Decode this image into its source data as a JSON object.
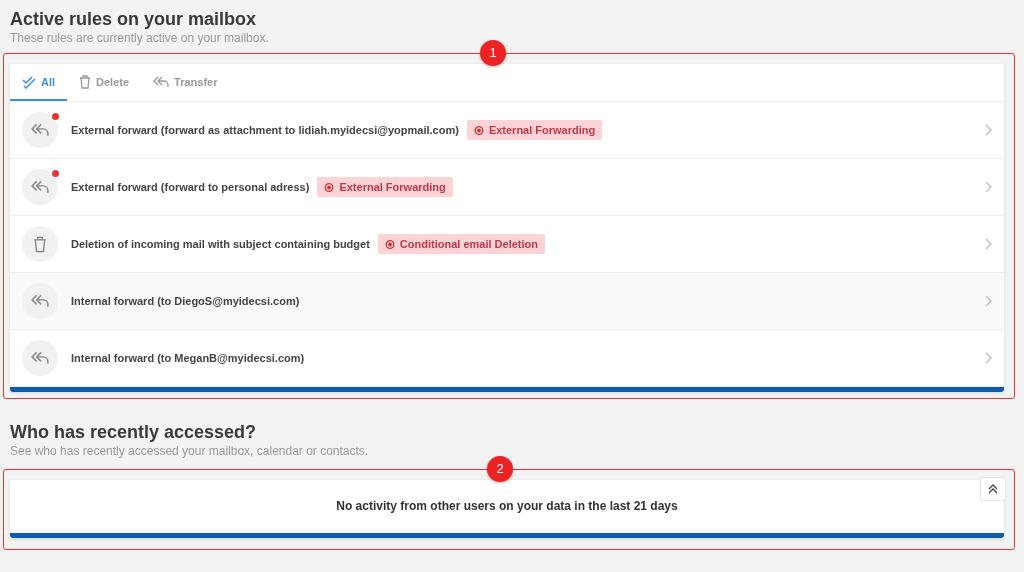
{
  "rules_section": {
    "title": "Active rules on your mailbox",
    "subtitle": "These rules are currently active on your mailbox.",
    "annotation": "1",
    "tabs": [
      {
        "label": "All",
        "selected": true
      },
      {
        "label": "Delete",
        "selected": false
      },
      {
        "label": "Transfer",
        "selected": false
      }
    ],
    "rules": [
      {
        "kind": "forward",
        "alert": true,
        "hovered": false,
        "text": "External forward (forward as attachment to lidiah.myidecsi@yopmail.com)",
        "tag": "External Forwarding"
      },
      {
        "kind": "forward",
        "alert": true,
        "hovered": false,
        "text": "External forward (forward to personal adress)",
        "tag": "External Forwarding"
      },
      {
        "kind": "delete",
        "alert": false,
        "hovered": false,
        "text": "Deletion of incoming mail with subject containing budget",
        "tag": "Conditional email Deletion"
      },
      {
        "kind": "forward",
        "alert": false,
        "hovered": true,
        "text": "Internal forward (to DiegoS@myidecsi.com)"
      },
      {
        "kind": "forward",
        "alert": false,
        "hovered": false,
        "text": "Internal forward (to MeganB@myidecsi.com)"
      }
    ]
  },
  "access_section": {
    "title": "Who has recently accessed?",
    "subtitle": "See who has recently accessed your mailbox, calendar or contacts.",
    "annotation": "2",
    "message": "No activity from other users on your data in the last 21 days"
  }
}
